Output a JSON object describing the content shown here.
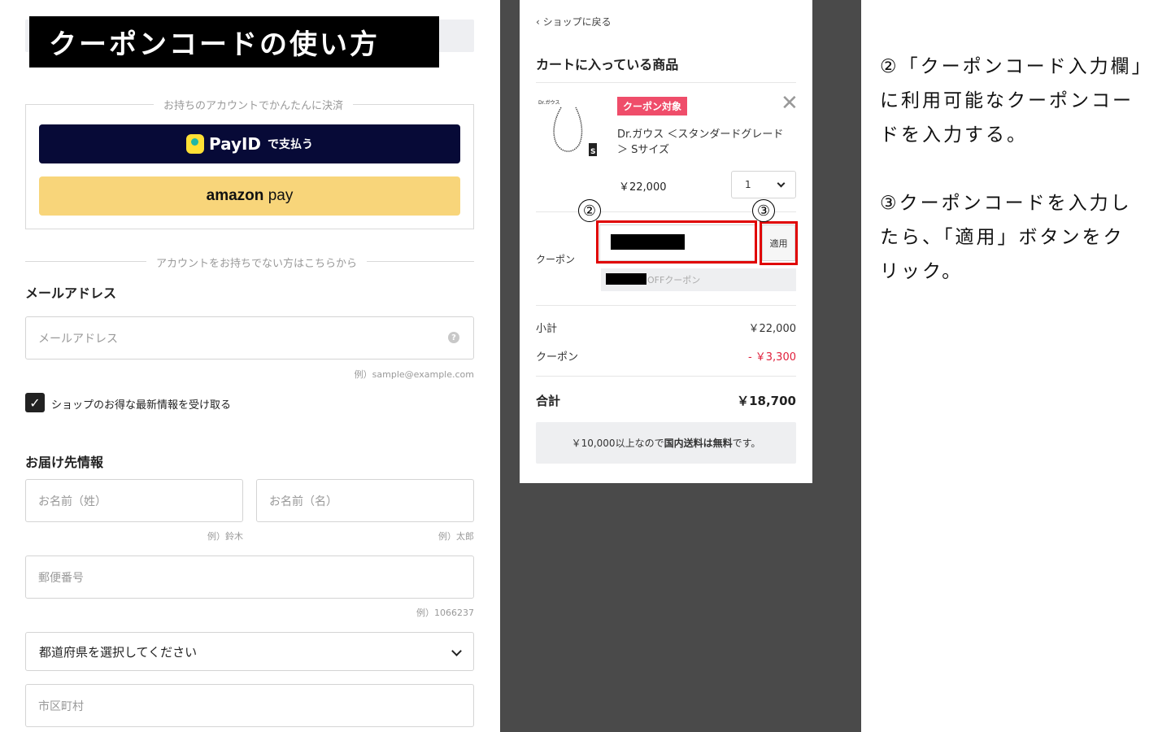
{
  "banner_title": "クーポンコードの使い方",
  "checkout": {
    "express_label": "お持ちのアカウントでかんたんに決済",
    "payid": {
      "brand": "PayID",
      "suffix": "で支払う",
      "color": "#070a37"
    },
    "amazon": {
      "brand": "amazon",
      "suffix": "pay",
      "color": "#f8d57a"
    },
    "guest_label": "アカウントをお持ちでない方はこちらから",
    "email": {
      "heading": "メールアドレス",
      "placeholder": "メールアドレス",
      "hint": "例）sample@example.com",
      "help_icon": "question-icon"
    },
    "newsletter": {
      "label": "ショップのお得な最新情報を受け取る",
      "checked": true
    },
    "shipping": {
      "heading": "お届け先情報",
      "last_name": {
        "placeholder": "お名前（姓）",
        "hint": "例）鈴木"
      },
      "first_name": {
        "placeholder": "お名前（名）",
        "hint": "例）太郎"
      },
      "postal": {
        "placeholder": "郵便番号",
        "hint": "例）1066237"
      },
      "prefecture": {
        "value": "都道府県を選択してください"
      },
      "city": {
        "placeholder": "市区町村"
      }
    }
  },
  "cart": {
    "back_label": "ショップに戻る",
    "title": "カートに入っている商品",
    "item": {
      "badge": "クーポン対象",
      "name": "Dr.ガウス ＜スタンダードグレード＞ Sサイズ",
      "price": "￥22,000",
      "qty": "1",
      "thumb_brand": "Dr.ガウス",
      "thumb_size": "S"
    },
    "coupon_label": "クーポン",
    "apply_label": "適用",
    "applied_suffix": "OFFクーポン",
    "subtotal_label": "小計",
    "subtotal_value": "￥22,000",
    "discount_label": "クーポン",
    "discount_value": "- ￥3,300",
    "total_label": "合計",
    "total_value": "￥18,700",
    "shipping_pre": "￥10,000以上なので",
    "shipping_bold": "国内送料は無料",
    "shipping_post": "です。",
    "accent_color": "#ef4d6a"
  },
  "annotations": {
    "marker_2": "②",
    "marker_3": "③",
    "highlight_color": "#e00000"
  },
  "instructions": {
    "step2": "②「クーポンコード入力欄」に利用可能なクーポンコードを入力する。",
    "step3": "③クーポンコードを入力したら、「適用」ボタンをクリック。"
  }
}
